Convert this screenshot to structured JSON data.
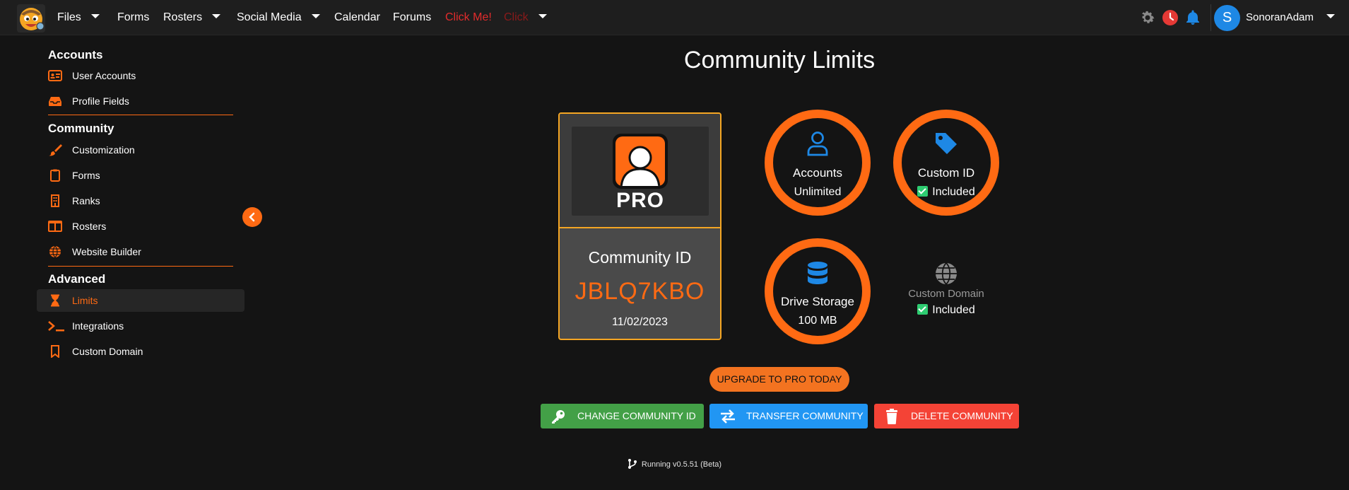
{
  "navbar": {
    "items": [
      {
        "label": "Files",
        "dropdown": true
      },
      {
        "label": "Forms",
        "dropdown": false
      },
      {
        "label": "Rosters",
        "dropdown": true
      },
      {
        "label": "Social Media",
        "dropdown": true
      },
      {
        "label": "Calendar",
        "dropdown": false
      },
      {
        "label": "Forums",
        "dropdown": false
      },
      {
        "label": "Click Me!",
        "dropdown": false
      },
      {
        "label": "Click",
        "dropdown": true
      }
    ],
    "icons": [
      "gear-icon",
      "clock-icon",
      "bell-icon"
    ],
    "user": {
      "avatar_initial": "S",
      "name": "SonoranAdam"
    }
  },
  "sidebar": {
    "sections": [
      {
        "heading": "Accounts",
        "items": [
          {
            "label": "User Accounts",
            "icon": "id-card-icon"
          },
          {
            "label": "Profile Fields",
            "icon": "inbox-icon"
          }
        ]
      },
      {
        "heading": "Community",
        "items": [
          {
            "label": "Customization",
            "icon": "brush-icon"
          },
          {
            "label": "Forms",
            "icon": "clipboard-icon"
          },
          {
            "label": "Ranks",
            "icon": "building-icon"
          },
          {
            "label": "Rosters",
            "icon": "columns-icon"
          },
          {
            "label": "Website Builder",
            "icon": "globe-icon"
          }
        ]
      },
      {
        "heading": "Advanced",
        "items": [
          {
            "label": "Limits",
            "icon": "hourglass-icon",
            "active": true
          },
          {
            "label": "Integrations",
            "icon": "terminal-icon"
          },
          {
            "label": "Custom Domain",
            "icon": "bookmark-icon"
          }
        ]
      }
    ]
  },
  "page": {
    "title": "Community Limits",
    "card": {
      "badge": "PRO",
      "label": "Community ID",
      "id": "JBLQ7KBO",
      "date": "11/02/2023"
    },
    "features": {
      "accounts": {
        "title": "Accounts",
        "value": "Unlimited",
        "icon": "user-icon"
      },
      "custom_id": {
        "title": "Custom ID",
        "value": "Included",
        "icon": "tag-icon"
      },
      "drive_storage": {
        "title": "Drive Storage",
        "value": "100 MB",
        "icon": "database-icon"
      },
      "custom_domain": {
        "title": "Custom Domain",
        "value": "Included",
        "icon": "globe-icon"
      }
    },
    "upgrade_label": "UPGRADE TO PRO TODAY",
    "actions": {
      "change_id": "CHANGE COMMUNITY ID",
      "transfer": "TRANSFER COMMUNITY",
      "delete": "DELETE COMMUNITY"
    },
    "version": "Running v0.5.51 (Beta)"
  },
  "colors": {
    "accent": "#ff6a13",
    "gold_border": "#f5a623",
    "feature_icon": "#1e88e5",
    "success": "#2ecc71"
  }
}
